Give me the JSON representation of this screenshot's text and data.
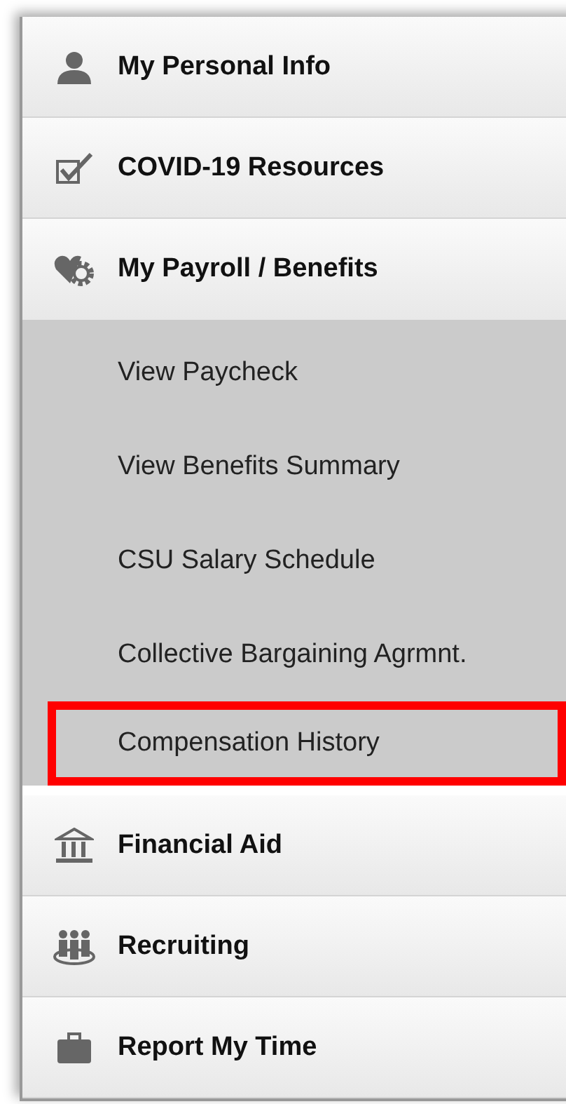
{
  "menu": [
    {
      "label": "My Personal Info",
      "expanded": false
    },
    {
      "label": "COVID-19 Resources",
      "expanded": false
    },
    {
      "label": "My Payroll / Benefits",
      "expanded": true,
      "children": [
        {
          "label": "View Paycheck",
          "highlighted": false
        },
        {
          "label": "View Benefits Summary",
          "highlighted": false
        },
        {
          "label": "CSU Salary Schedule",
          "highlighted": false
        },
        {
          "label": "Collective Bargaining Agrmnt.",
          "highlighted": false
        },
        {
          "label": "Compensation History",
          "highlighted": true
        }
      ]
    },
    {
      "label": "Financial Aid",
      "expanded": false
    },
    {
      "label": "Recruiting",
      "expanded": false
    },
    {
      "label": "Report My Time",
      "expanded": false
    }
  ]
}
